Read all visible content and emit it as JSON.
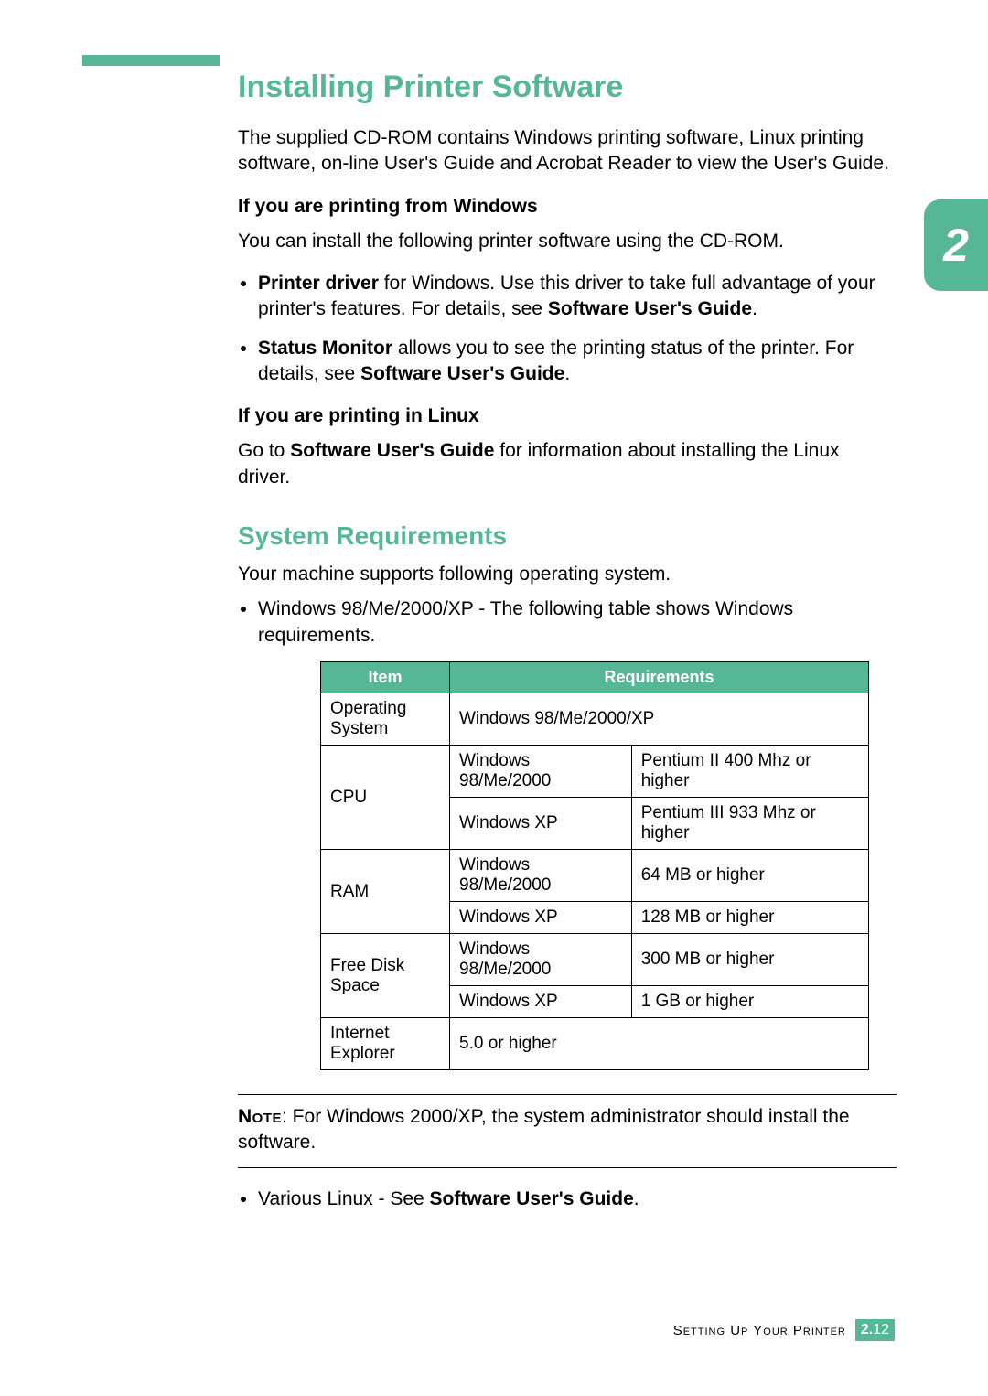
{
  "chapter_number": "2",
  "title": "Installing Printer Software",
  "intro": "The supplied CD-ROM contains Windows printing software, Linux printing software, on-line User's Guide and Acrobat Reader to view the User's Guide.",
  "windows": {
    "heading": "If you are printing from Windows",
    "lead": "You can install the following printer software using the CD-ROM.",
    "bullets": [
      {
        "b1": "Printer driver",
        "t1": " for Windows. Use this driver to take full advantage of your printer's features. For details, see ",
        "b2": "Software User's Guide",
        "t2": "."
      },
      {
        "b1": "Status Monitor",
        "t1": " allows you to see the printing status of the printer. For details, see ",
        "b2": "Software User's Guide",
        "t2": "."
      }
    ]
  },
  "linux": {
    "heading": "If you are printing in Linux",
    "pre": "Go to ",
    "bold": "Software User's Guide",
    "post": " for information about installing the Linux driver."
  },
  "sysreq": {
    "heading": "System Requirements",
    "lead": "Your machine supports following operating system.",
    "bullet": "Windows 98/Me/2000/XP - The following table shows Windows requirements.",
    "table": {
      "headers": {
        "item": "Item",
        "req": "Requirements"
      },
      "rows": {
        "os": {
          "item": "Operating System",
          "req": "Windows 98/Me/2000/XP"
        },
        "cpu": {
          "item": "CPU",
          "r1a": "Windows 98/Me/2000",
          "r1b": "Pentium II 400 Mhz or higher",
          "r2a": "Windows XP",
          "r2b": "Pentium III 933 Mhz or higher"
        },
        "ram": {
          "item": "RAM",
          "r1a": "Windows 98/Me/2000",
          "r1b": "64 MB or higher",
          "r2a": "Windows XP",
          "r2b": "128 MB or higher"
        },
        "disk": {
          "item": "Free Disk Space",
          "r1a": "Windows 98/Me/2000",
          "r1b": "300 MB or higher",
          "r2a": "Windows XP",
          "r2b": "1 GB or higher"
        },
        "ie": {
          "item": "Internet Explorer",
          "req": "5.0 or higher"
        }
      }
    }
  },
  "note": {
    "label": "Note",
    "text": ": For Windows 2000/XP, the system administrator should install the software."
  },
  "linux_bullet": {
    "pre": "Various Linux - See ",
    "bold": "Software User's Guide",
    "post": "."
  },
  "footer": {
    "section": "Setting Up Your Printer",
    "page_prefix": "2.",
    "page_suffix": "12"
  }
}
